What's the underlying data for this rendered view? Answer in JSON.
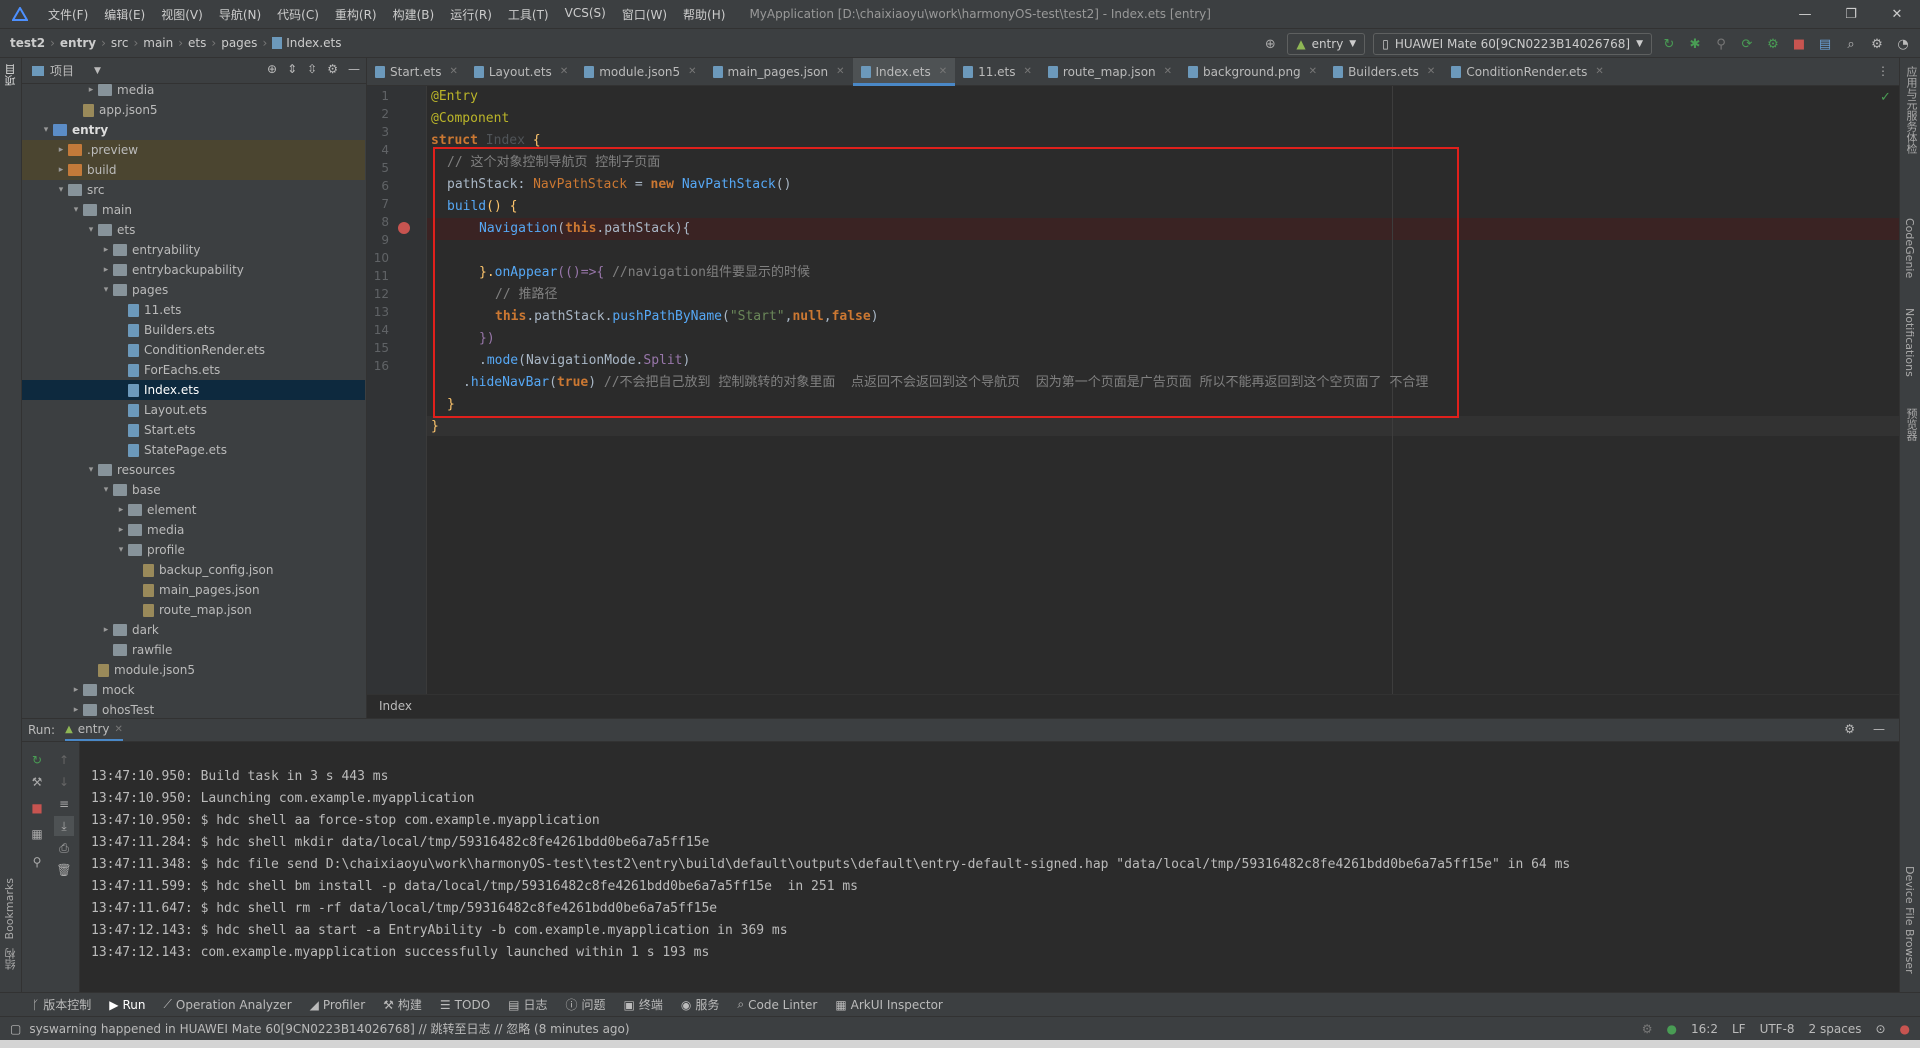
{
  "titlebar": {
    "menu": [
      "文件(F)",
      "编辑(E)",
      "视图(V)",
      "导航(N)",
      "代码(C)",
      "重构(R)",
      "构建(B)",
      "运行(R)",
      "工具(T)",
      "VCS(S)",
      "窗口(W)",
      "帮助(H)"
    ],
    "window_title": "MyApplication [D:\\chaixiaoyu\\work\\harmonyOS-test\\test2] - Index.ets [entry]"
  },
  "navbar": {
    "crumbs": [
      "test2",
      "entry",
      "src",
      "main",
      "ets",
      "pages",
      "Index.ets"
    ],
    "run_config": "entry",
    "device": "HUAWEI Mate 60[9CN0223B14026768]"
  },
  "left_stripe": {
    "project_label": "项目",
    "bookmarks_label": "Bookmarks",
    "structure_label": "结构"
  },
  "project_panel": {
    "title": "项目",
    "tree": [
      {
        "label": "media",
        "depth": 4,
        "type": "folder",
        "arrow": "›"
      },
      {
        "label": "app.json5",
        "depth": 3,
        "type": "json",
        "arrow": ""
      },
      {
        "label": "entry",
        "depth": 1,
        "type": "folder-blue",
        "arrow": "⌄",
        "bold": true
      },
      {
        "label": ".preview",
        "depth": 2,
        "type": "folder-orange",
        "arrow": "›",
        "hl": true
      },
      {
        "label": "build",
        "depth": 2,
        "type": "folder-orange",
        "arrow": "›",
        "hl": true
      },
      {
        "label": "src",
        "depth": 2,
        "type": "folder",
        "arrow": "⌄"
      },
      {
        "label": "main",
        "depth": 3,
        "type": "folder",
        "arrow": "⌄"
      },
      {
        "label": "ets",
        "depth": 4,
        "type": "folder",
        "arrow": "⌄"
      },
      {
        "label": "entryability",
        "depth": 5,
        "type": "folder",
        "arrow": "›"
      },
      {
        "label": "entrybackupability",
        "depth": 5,
        "type": "folder",
        "arrow": "›"
      },
      {
        "label": "pages",
        "depth": 5,
        "type": "folder",
        "arrow": "⌄"
      },
      {
        "label": "11.ets",
        "depth": 6,
        "type": "file",
        "arrow": ""
      },
      {
        "label": "Builders.ets",
        "depth": 6,
        "type": "file",
        "arrow": ""
      },
      {
        "label": "ConditionRender.ets",
        "depth": 6,
        "type": "file",
        "arrow": ""
      },
      {
        "label": "ForEachs.ets",
        "depth": 6,
        "type": "file",
        "arrow": ""
      },
      {
        "label": "Index.ets",
        "depth": 6,
        "type": "file",
        "arrow": "",
        "sel": true
      },
      {
        "label": "Layout.ets",
        "depth": 6,
        "type": "file",
        "arrow": ""
      },
      {
        "label": "Start.ets",
        "depth": 6,
        "type": "file",
        "arrow": ""
      },
      {
        "label": "StatePage.ets",
        "depth": 6,
        "type": "file",
        "arrow": ""
      },
      {
        "label": "resources",
        "depth": 4,
        "type": "folder",
        "arrow": "⌄"
      },
      {
        "label": "base",
        "depth": 5,
        "type": "folder",
        "arrow": "⌄"
      },
      {
        "label": "element",
        "depth": 6,
        "type": "folder",
        "arrow": "›"
      },
      {
        "label": "media",
        "depth": 6,
        "type": "folder",
        "arrow": "›"
      },
      {
        "label": "profile",
        "depth": 6,
        "type": "folder",
        "arrow": "⌄"
      },
      {
        "label": "backup_config.json",
        "depth": 7,
        "type": "json",
        "arrow": ""
      },
      {
        "label": "main_pages.json",
        "depth": 7,
        "type": "json",
        "arrow": ""
      },
      {
        "label": "route_map.json",
        "depth": 7,
        "type": "json",
        "arrow": ""
      },
      {
        "label": "dark",
        "depth": 5,
        "type": "folder",
        "arrow": "›"
      },
      {
        "label": "rawfile",
        "depth": 5,
        "type": "folder",
        "arrow": ""
      },
      {
        "label": "module.json5",
        "depth": 4,
        "type": "json",
        "arrow": ""
      },
      {
        "label": "mock",
        "depth": 3,
        "type": "folder",
        "arrow": "›"
      },
      {
        "label": "ohosTest",
        "depth": 3,
        "type": "folder",
        "arrow": "›"
      }
    ]
  },
  "editor_tabs": [
    {
      "label": "Start.ets",
      "active": false
    },
    {
      "label": "Layout.ets",
      "active": false
    },
    {
      "label": "module.json5",
      "active": false
    },
    {
      "label": "main_pages.json",
      "active": false
    },
    {
      "label": "Index.ets",
      "active": true
    },
    {
      "label": "11.ets",
      "active": false
    },
    {
      "label": "route_map.json",
      "active": false
    },
    {
      "label": "background.png",
      "active": false
    },
    {
      "label": "Builders.ets",
      "active": false
    },
    {
      "label": "ConditionRender.ets",
      "active": false
    }
  ],
  "code": {
    "line_numbers": [
      "1",
      "2",
      "3",
      "4",
      "5",
      "6",
      "7",
      "8",
      "9",
      "10",
      "11",
      "12",
      "13",
      "14",
      "15",
      "16"
    ],
    "l1": "@Entry",
    "l2": "@Component",
    "l3_kw": "struct",
    "l3_name": "Index",
    "l3_brace": "{",
    "l4": "// 这个对象控制导航页 控制子页面",
    "l5_a": "pathStack",
    "l5_b": ": ",
    "l5_type": "NavPathStack",
    "l5_c": " = ",
    "l5_new": "new",
    "l5_ctor": "NavPathStack",
    "l5_d": "()",
    "l6_a": "build",
    "l6_b": "() {",
    "l7_fn": "Navigation",
    "l7_a": "(",
    "l7_this": "this",
    "l7_b": ".pathStack){",
    "l9_a": "}.",
    "l9_fn": "onAppear",
    "l9_b": "(()=>{ ",
    "l9_cm": "//navigation组件要显示的时候",
    "l10": "// 推路径",
    "l11_this": "this",
    "l11_a": ".pathStack.",
    "l11_fn": "pushPathByName",
    "l11_b": "(",
    "l11_str": "\"Start\"",
    "l11_c": ",",
    "l11_null": "null",
    "l11_d": ",",
    "l11_false": "false",
    "l11_e": ")",
    "l12": "})",
    "l13_a": ".",
    "l13_fn": "mode",
    "l13_b": "(NavigationMode.",
    "l13_c": "Split",
    "l13_d": ")",
    "l14_a": ".",
    "l14_fn": "hideNavBar",
    "l14_b": "(",
    "l14_true": "true",
    "l14_c": ") ",
    "l14_cm": "//不会把自己放到 控制跳转的对象里面  点返回不会返回到这个导航页  因为第一个页面是广告页面 所以不能再返回到这个空页面了 不合理",
    "l15": "}",
    "l16": "}"
  },
  "editor_breadcrumb": "Index",
  "run_panel": {
    "label": "Run:",
    "tab": "entry",
    "lines": [
      "13:47:10.950: Build task in 3 s 443 ms",
      "13:47:10.950: Launching com.example.myapplication",
      "13:47:10.950: $ hdc shell aa force-stop com.example.myapplication",
      "13:47:11.284: $ hdc shell mkdir data/local/tmp/59316482c8fe4261bdd0be6a7a5ff15e",
      "13:47:11.348: $ hdc file send D:\\chaixiaoyu\\work\\harmonyOS-test\\test2\\entry\\build\\default\\outputs\\default\\entry-default-signed.hap \"data/local/tmp/59316482c8fe4261bdd0be6a7a5ff15e\" in 64 ms",
      "13:47:11.599: $ hdc shell bm install -p data/local/tmp/59316482c8fe4261bdd0be6a7a5ff15e  in 251 ms",
      "13:47:11.647: $ hdc shell rm -rf data/local/tmp/59316482c8fe4261bdd0be6a7a5ff15e",
      "13:47:12.143: $ hdc shell aa start -a EntryAbility -b com.example.myapplication in 369 ms",
      "13:47:12.143: com.example.myapplication successfully launched within 1 s 193 ms"
    ]
  },
  "bottom_tools": [
    {
      "icon": "ᚴ",
      "label": "版本控制"
    },
    {
      "icon": "▶",
      "label": "Run",
      "active": true
    },
    {
      "icon": "⟋",
      "label": "Operation Analyzer"
    },
    {
      "icon": "◢",
      "label": "Profiler"
    },
    {
      "icon": "⚒",
      "label": "构建"
    },
    {
      "icon": "☰",
      "label": "TODO"
    },
    {
      "icon": "▤",
      "label": "日志"
    },
    {
      "icon": "ⓘ",
      "label": "问题"
    },
    {
      "icon": "▣",
      "label": "终端"
    },
    {
      "icon": "◉",
      "label": "服务"
    },
    {
      "icon": "⌕",
      "label": "Code Linter"
    },
    {
      "icon": "▦",
      "label": "ArkUI Inspector"
    }
  ],
  "right_stripe": {
    "label1": "应用与元服务体检",
    "label2": "CodeGenie",
    "label3": "Notifications",
    "label4": "预览器",
    "label5": "Device File Browser"
  },
  "statusbar": {
    "message": "syswarning happened in HUAWEI Mate 60[9CN0223B14026768] // 跳转至日志 // 忽略 (8 minutes ago)",
    "position": "16:2",
    "line_sep": "LF",
    "encoding": "UTF-8",
    "indent": "2 spaces"
  },
  "colors": {
    "accent": "#4a88c7",
    "error_box": "#e0201c",
    "run_green": "#499c54",
    "stop_red": "#c75450"
  }
}
